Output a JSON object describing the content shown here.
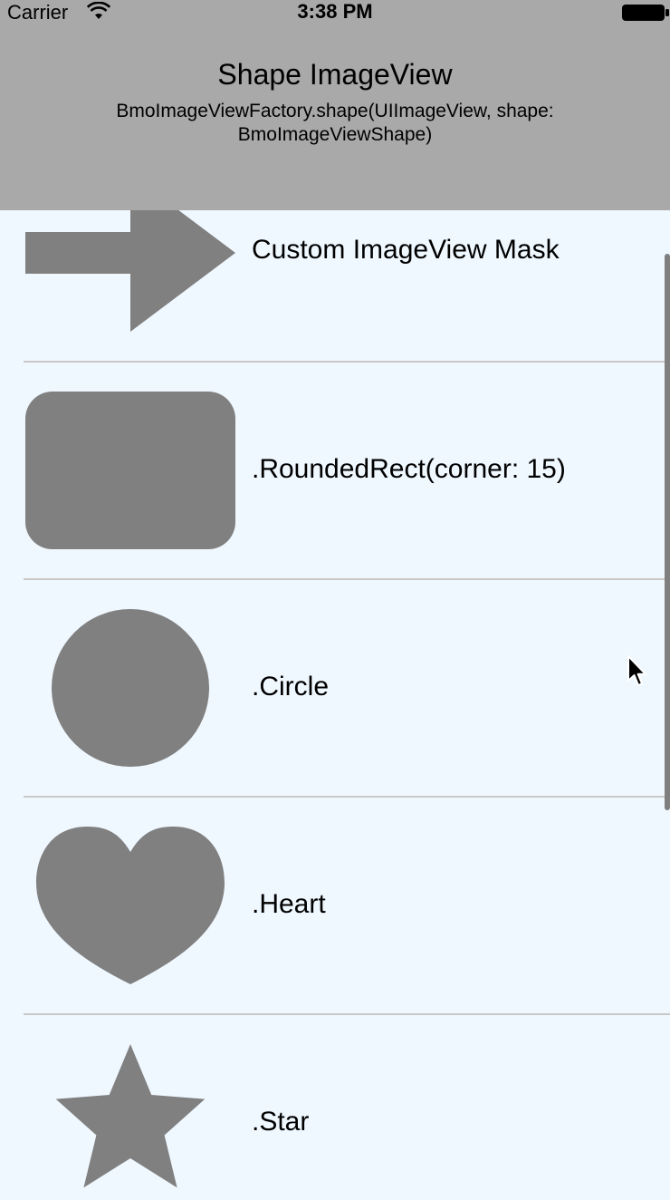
{
  "status_bar": {
    "carrier": "Carrier",
    "time": "3:38 PM",
    "icons": [
      "wifi-icon",
      "battery-icon"
    ]
  },
  "nav": {
    "title": "Shape ImageView",
    "subtitle": "BmoImageViewFactory.shape(UIImageView, shape: BmoImageViewShape)",
    "background": "#A9A9A9"
  },
  "table": {
    "background": "#F0F8FF",
    "shape_color": "#808080",
    "rows": [
      {
        "label": "Custom ImageView Mask",
        "shape": "arrow"
      },
      {
        "label": ".RoundedRect(corner: 15)",
        "shape": "rounded-rect"
      },
      {
        "label": ".Circle",
        "shape": "circle"
      },
      {
        "label": ".Heart",
        "shape": "heart"
      },
      {
        "label": ".Star",
        "shape": "star"
      }
    ]
  }
}
